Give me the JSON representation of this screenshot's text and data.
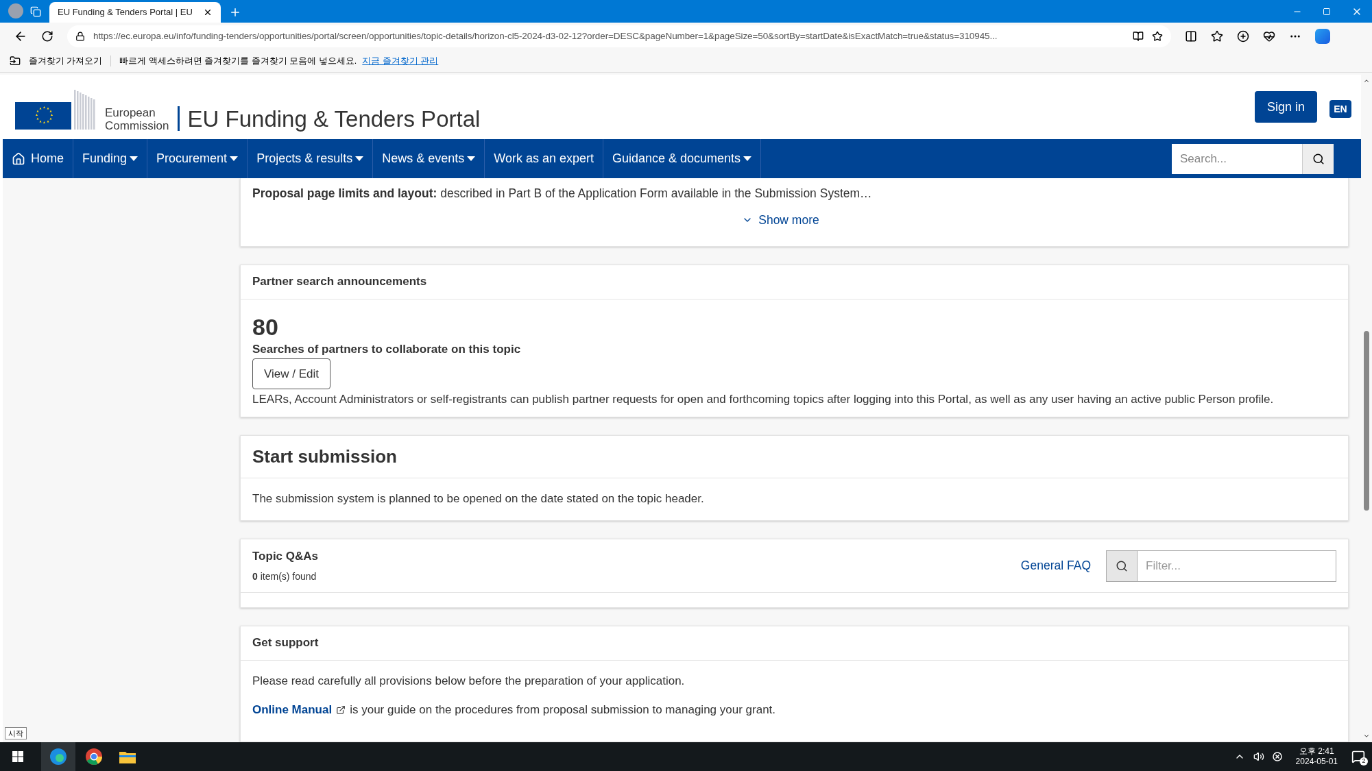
{
  "browser": {
    "tab": {
      "title": "EU Funding & Tenders Portal | EU"
    },
    "address": "https://ec.europa.eu/info/funding-tenders/opportunities/portal/screen/opportunities/topic-details/horizon-cl5-2024-d3-02-12?order=DESC&pageNumber=1&pageSize=50&sortBy=startDate&isExactMatch=true&status=310945...",
    "favorites_bar": {
      "import": "즐겨찾기 가져오기",
      "hint": "빠르게 액세스하려면 즐겨찾기를 즐겨찾기 모음에 넣으세요.",
      "link": "지금 즐겨찾기 관리"
    }
  },
  "header": {
    "org_line1": "European",
    "org_line2": "Commission",
    "title": "EU Funding & Tenders Portal",
    "sign_in": "Sign in",
    "language": "EN"
  },
  "nav": {
    "items": [
      {
        "label": "Home",
        "kind": "home",
        "has_menu": false
      },
      {
        "label": "Funding",
        "kind": "link",
        "has_menu": true
      },
      {
        "label": "Procurement",
        "kind": "link",
        "has_menu": true
      },
      {
        "label": "Projects & results",
        "kind": "link",
        "has_menu": true
      },
      {
        "label": "News & events",
        "kind": "link",
        "has_menu": true
      },
      {
        "label": "Work as an expert",
        "kind": "link",
        "has_menu": false
      },
      {
        "label": "Guidance & documents",
        "kind": "link",
        "has_menu": true
      }
    ],
    "search": {
      "placeholder": "Search..."
    }
  },
  "proposal_limits": {
    "text": "**Proposal page limits and layout:** described in Part B of the Application Form available in the Submission System…",
    "show_more": "Show more"
  },
  "partner_search": {
    "title": "Partner search announcements",
    "count": "80",
    "subtitle": "Searches of partners to collaborate on this topic",
    "button": "View / Edit",
    "description": "LEARs, Account Administrators or self-registrants can publish partner requests for open and forthcoming topics after logging into this Portal, as well as any user having an active public Person profile."
  },
  "start_submission": {
    "title": "Start submission",
    "text": "The submission system is planned to be opened on the date stated on the topic header."
  },
  "topic_qas": {
    "title": "Topic Q&As",
    "found": "**0** item(s) found",
    "faq_link": "General FAQ",
    "filter": {
      "placeholder": "Filter..."
    }
  },
  "get_support": {
    "title": "Get support",
    "text": "Please read carefully all provisions below before the preparation of your application.",
    "manual_link": "Online Manual",
    "manual_text": "is your guide on the procedures from proposal submission to managing your grant."
  },
  "start_tooltip": "시작",
  "taskbar": {
    "time": "오후 2:41",
    "date": "2024-05-01",
    "notifications": "2"
  }
}
